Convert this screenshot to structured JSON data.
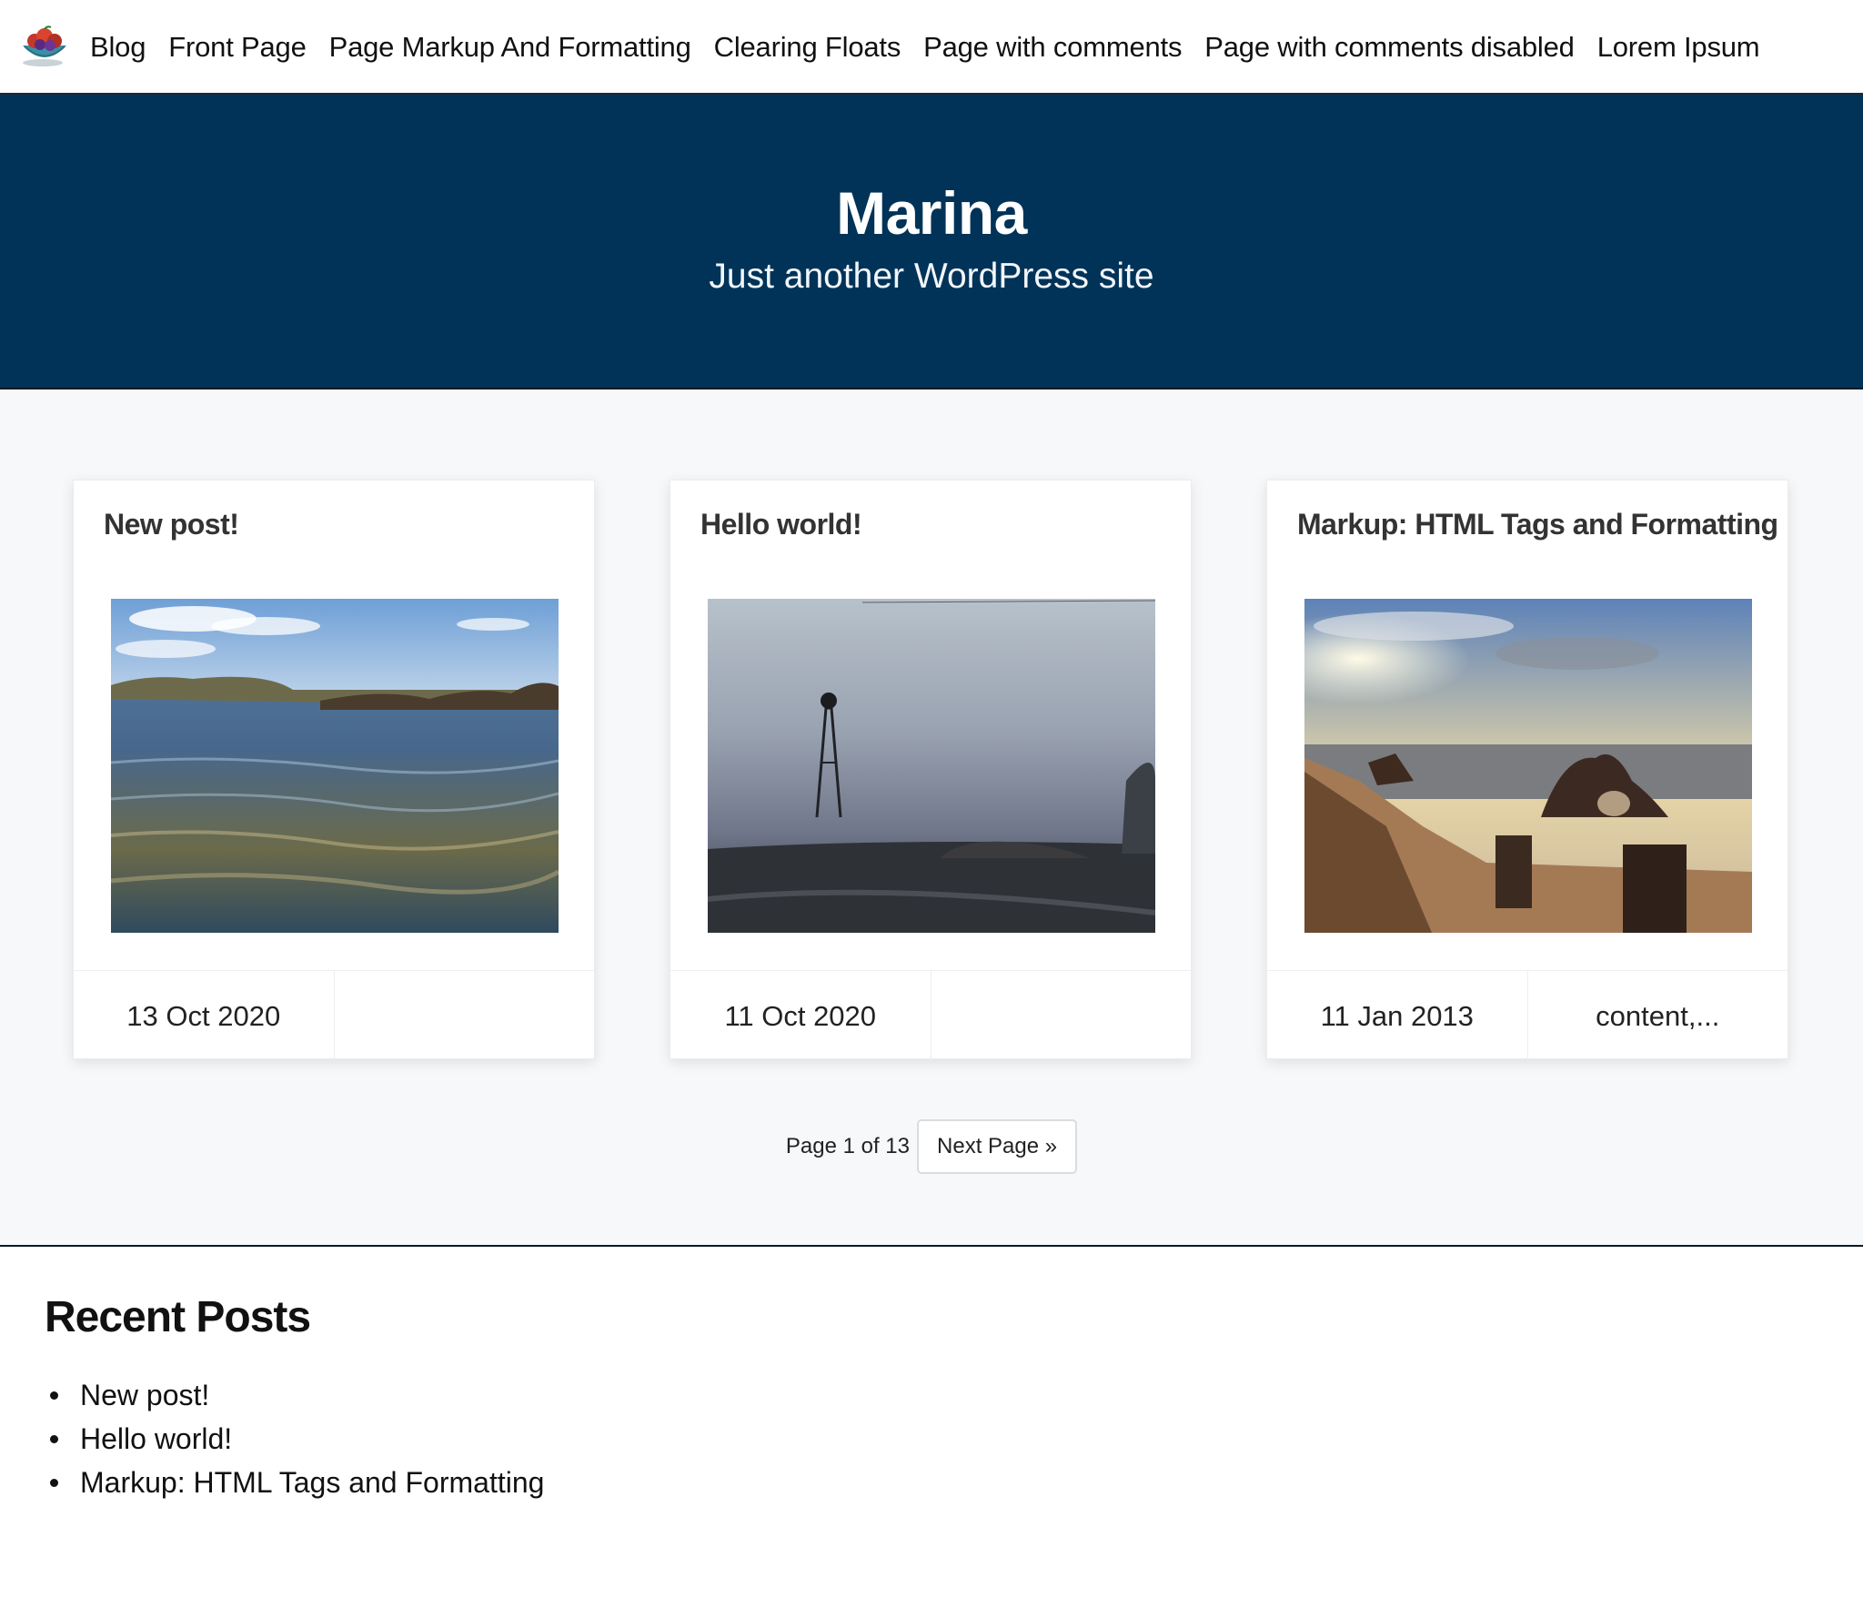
{
  "nav": {
    "logo_icon": "fruit-bowl-icon",
    "links": [
      "Blog",
      "Front Page",
      "Page Markup And Formatting",
      "Clearing Floats",
      "Page with comments",
      "Page with comments disabled",
      "Lorem Ipsum"
    ]
  },
  "hero": {
    "title": "Marina",
    "tagline": "Just another WordPress site",
    "background_color": "#013358"
  },
  "posts": [
    {
      "title": "New post!",
      "image": "sea-water-photo",
      "date": "13 Oct 2020",
      "excerpt": ""
    },
    {
      "title": "Hello world!",
      "image": "foggy-windmill-photo",
      "date": "11 Oct 2020",
      "excerpt": ""
    },
    {
      "title": "Markup: HTML Tags and Formatting",
      "image": "rocky-beach-sunset-photo",
      "date": "11 Jan 2013",
      "excerpt": "content,..."
    }
  ],
  "pagination": {
    "info": "Page 1 of 13",
    "next_label": "Next Page »"
  },
  "recent_posts": {
    "heading": "Recent Posts",
    "items": [
      "New post!",
      "Hello world!",
      "Markup: HTML Tags and Formatting"
    ]
  }
}
